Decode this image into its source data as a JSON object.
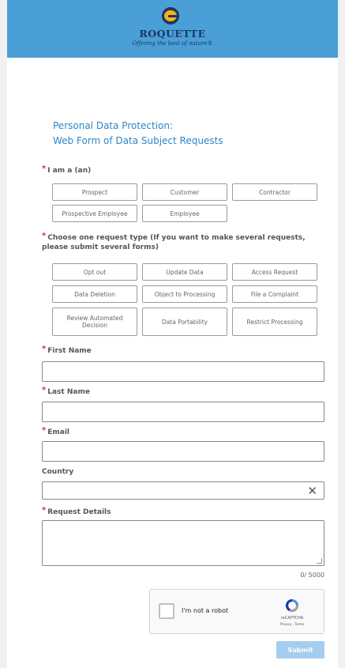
{
  "header": {
    "brand": "ROQUETTE",
    "tagline": "Offering the best of nature®"
  },
  "title": {
    "line1": "Personal Data Protection:",
    "line2": "Web Form of Data Subject Requests"
  },
  "i_am": {
    "label": "I am a (an)",
    "options": [
      "Prospect",
      "Customer",
      "Contractor",
      "Prospective Employee",
      "Employee"
    ]
  },
  "request_type": {
    "label_line1": "Choose one request type (If you want to make several requests,",
    "label_line2": "please submit several forms)",
    "options": [
      "Opt out",
      "Update Data",
      "Access Request",
      "Data Deletion",
      "Object to Processing",
      "File a Complaint",
      "Review Automated Decision",
      "Data Portability",
      "Restrict Processing"
    ]
  },
  "fields": {
    "first_name": "First Name",
    "last_name": "Last Name",
    "email": "Email",
    "country": "Country",
    "request_details": "Request Details"
  },
  "required_marker": "*",
  "clear_glyph": "✕",
  "counter": "0/ 5000",
  "captcha": {
    "label": "I'm not a robot",
    "brand": "reCAPTCHA",
    "links": "Privacy - Terms"
  },
  "submit_label": "Submit",
  "colors": {
    "header_bg": "#4a9fd6",
    "title": "#2e86c8",
    "required": "#d0312d",
    "submit_bg": "#a5cdef",
    "brand_navy": "#1c3760",
    "brand_gold": "#f5b21a"
  }
}
